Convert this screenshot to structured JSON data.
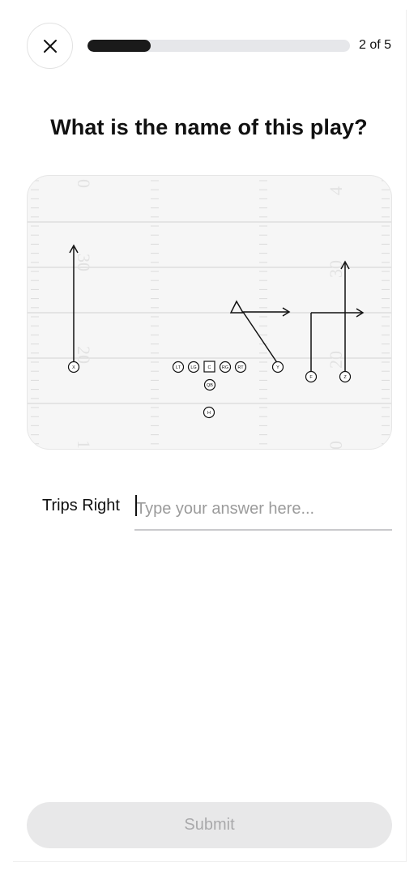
{
  "header": {
    "close_icon": "close-icon",
    "progress": {
      "current": 2,
      "total": 5,
      "fraction": 0.24
    },
    "step_label": "2 of 5"
  },
  "question": {
    "text": "What is the name of this play?"
  },
  "field": {
    "yard_numbers": [
      "0",
      "30",
      "20",
      "1",
      "4",
      "30",
      "20",
      "0"
    ],
    "players": {
      "X": "X",
      "LT": "LT",
      "LG": "LG",
      "C": "C",
      "RG": "RG",
      "RT": "RT",
      "QB": "QB",
      "H": "H",
      "Y": "Y",
      "F": "F",
      "Z": "Z"
    }
  },
  "answer": {
    "label": "Trips Right",
    "placeholder": "Type your answer here...",
    "value": ""
  },
  "submit": {
    "label": "Submit"
  }
}
